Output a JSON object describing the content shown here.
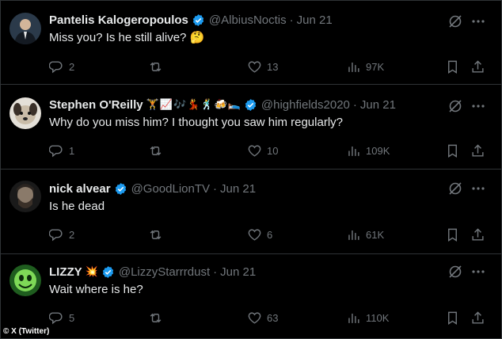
{
  "tweets": [
    {
      "name": "Pantelis Kalogeropoulos",
      "handle": "@AlbiusNoctis",
      "sep": "·",
      "date": "Jun 21",
      "text": "Miss you? Is he still alive? 🤔",
      "replies": "2",
      "reposts": "",
      "likes": "13",
      "views": "97K",
      "emojis": []
    },
    {
      "name": "Stephen O'Reilly",
      "handle": "@highfields2020",
      "sep": "·",
      "date": "Jun 21",
      "text": "Why do you miss him?  I thought you saw him regularly?",
      "replies": "1",
      "reposts": "",
      "likes": "10",
      "views": "109K",
      "emojis": [
        "🏋",
        "📈",
        "🎶",
        "💃",
        "🕺",
        "🍻",
        "🛌"
      ]
    },
    {
      "name": "nick alvear",
      "handle": "@GoodLionTV",
      "sep": "·",
      "date": "Jun 21",
      "text": "Is he dead",
      "replies": "2",
      "reposts": "",
      "likes": "6",
      "views": "61K",
      "emojis": []
    },
    {
      "name": "LIZZY",
      "handle": "@LizzyStarrrdust",
      "sep": "·",
      "date": "Jun 21",
      "text": "Wait where is he?",
      "replies": "5",
      "reposts": "",
      "likes": "63",
      "views": "110K",
      "emojis": [
        "💥"
      ]
    }
  ],
  "icons": {
    "verified": "verified-badge-icon",
    "reply": "reply-icon",
    "repost": "repost-icon",
    "like": "heart-icon",
    "views": "views-icon",
    "bookmark": "bookmark-icon",
    "share": "share-icon",
    "grok": "grok-icon",
    "more": "more-icon"
  },
  "colors": {
    "background": "#000000",
    "text": "#e7e9ea",
    "muted": "#71767b",
    "verified": "#1d9bf0",
    "divider": "#2f3336"
  },
  "credit": "© X (Twitter)"
}
